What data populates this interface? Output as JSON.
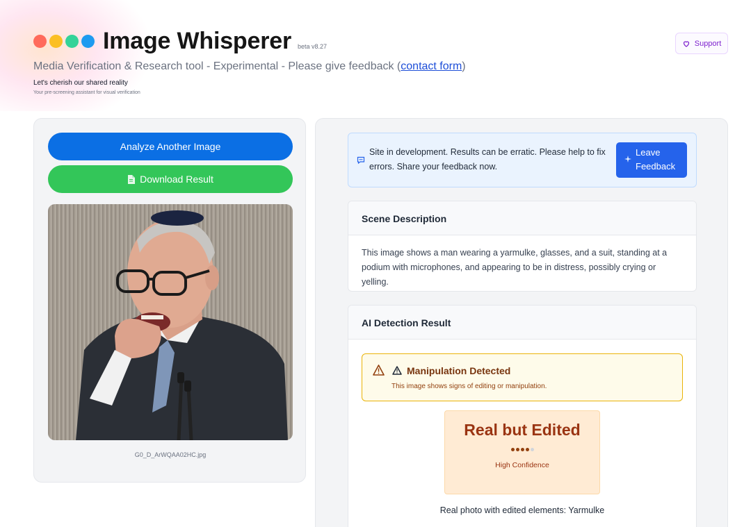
{
  "header": {
    "title": "Image Whisperer",
    "version": "beta v8.27",
    "subtitle_prefix": "Media Verification & Research tool - Experimental - Please give feedback (",
    "subtitle_link": "contact form",
    "subtitle_suffix": ")",
    "tagline": "Let's cherish our shared reality",
    "tagline_sub": "Your pre-screening assistant for visual verification",
    "logo_dot_colors": [
      "#ff6b5b",
      "#fbbf24",
      "#34d399",
      "#1e9bf0"
    ]
  },
  "support": {
    "label": "Support",
    "icon": "heart-icon"
  },
  "left": {
    "analyze_label": "Analyze Another Image",
    "download_label": "Download Result",
    "download_icon": "document-icon",
    "filename": "G0_D_ArWQAA02HC.jpg"
  },
  "notice": {
    "text": "Site in development. Results can be erratic. Please help to fix errors. Share your feedback now.",
    "button_line1": "Leave",
    "button_line2": "Feedback"
  },
  "scene": {
    "heading": "Scene Description",
    "text": "This image shows a man wearing a yarmulke, glasses, and a suit, standing at a podium with microphones, and appearing to be in distress, possibly crying or yelling."
  },
  "ai": {
    "heading": "AI Detection Result",
    "alert_title": "Manipulation Detected",
    "alert_text": "This image shows signs of editing or manipulation.",
    "verdict": "Real but Edited",
    "confidence_dots": {
      "filled": 4,
      "total": 5
    },
    "confidence_label": "High Confidence",
    "detail": "Real photo with edited elements: Yarmulke"
  },
  "colors": {
    "accent_blue": "#0b6fe4",
    "accent_green": "#33c659",
    "warning_border": "#eab308",
    "verdict_text": "#9a3412"
  }
}
